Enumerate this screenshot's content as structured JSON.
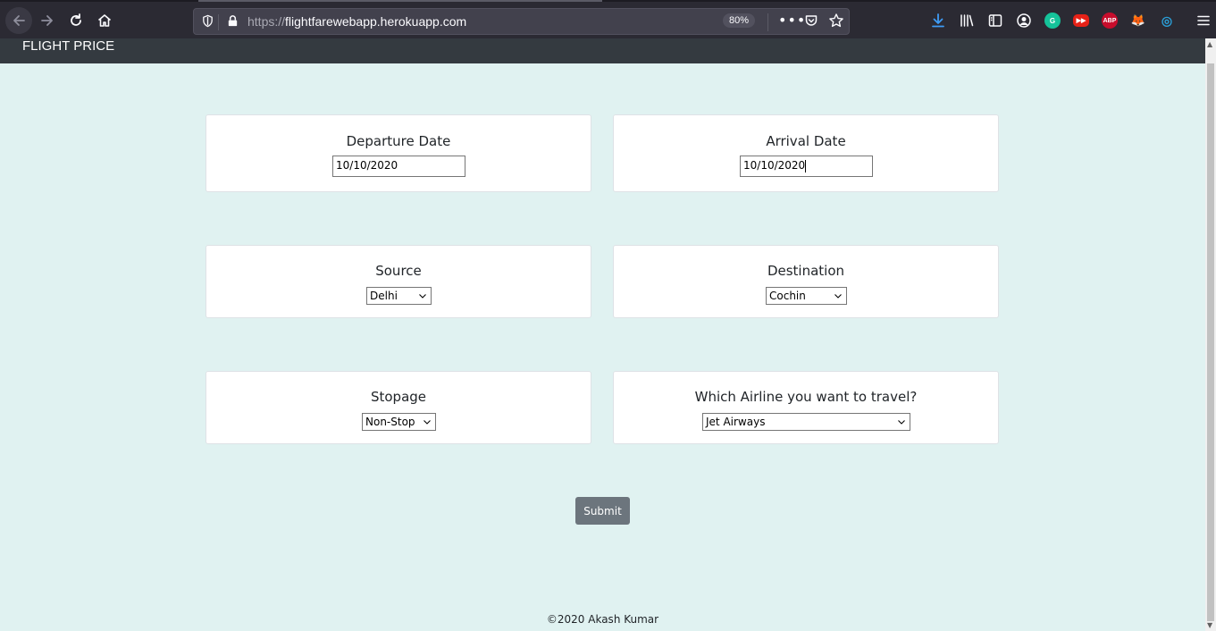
{
  "browser": {
    "url_prefix": "https://",
    "url_host": "flightfarewebapp.herokuapp.com",
    "zoom": "80%",
    "more_label": "•••",
    "extensions": [
      {
        "name": "grammarly",
        "label": "G",
        "color": "#15c39a"
      },
      {
        "name": "youtube-ext",
        "label": "▶▶",
        "color": "#e62117"
      },
      {
        "name": "adblock-plus",
        "label": "ABP",
        "color": "#c70d2c"
      },
      {
        "name": "metamask",
        "label": "🦊",
        "color": "#f6851b"
      },
      {
        "name": "ext-circle",
        "label": "◎",
        "color": "#0d6efd"
      }
    ]
  },
  "navbar": {
    "brand": "FLIGHT PRICE"
  },
  "form": {
    "departure": {
      "label": "Departure Date",
      "value": "10/10/2020"
    },
    "arrival": {
      "label": "Arrival Date",
      "value": "10/10/2020"
    },
    "source": {
      "label": "Source",
      "value": "Delhi"
    },
    "destination": {
      "label": "Destination",
      "value": "Cochin"
    },
    "stopage": {
      "label": "Stopage",
      "value": "Non-Stop"
    },
    "airline": {
      "label": "Which Airline you want to travel?",
      "value": "Jet Airways"
    },
    "submit_label": "Submit"
  },
  "footer": {
    "text": "©2020 Akash Kumar"
  }
}
